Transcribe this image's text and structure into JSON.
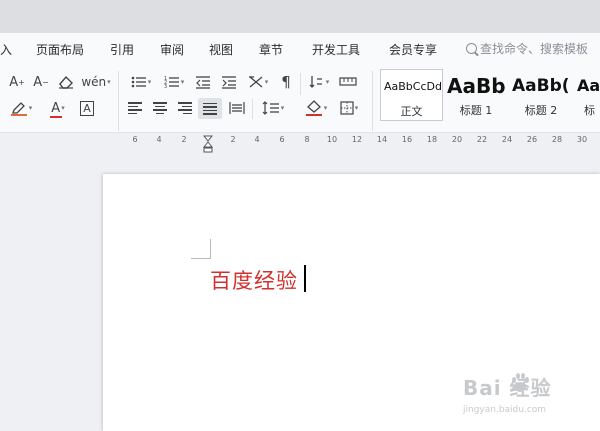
{
  "menu": {
    "items": [
      "入",
      "页面布局",
      "引用",
      "审阅",
      "视图",
      "章节",
      "开发工具",
      "会员专享"
    ],
    "search_placeholder": "查找命令、搜索模板"
  },
  "toolbar": {
    "row1": {
      "font_grow_icon": "font-grow-icon",
      "font_shrink_icon": "font-shrink-icon",
      "clear_format_icon": "eraser-icon",
      "phonetic_label": "wén",
      "bullets_icon": "bullets-list-icon",
      "numbering_icon": "numbered-list-icon",
      "outdent_icon": "outdent-icon",
      "indent_icon": "indent-icon",
      "chinese_layout_icon": "chinese-layout-icon",
      "show_marks_icon": "paragraph-mark-icon",
      "sort_icon": "sort-icon",
      "tab_ruler_icon": "tab-ruler-icon"
    },
    "row2": {
      "highlight_icon": "highlighter-icon",
      "font_color_label": "A",
      "char_border_label": "A",
      "align_left_icon": "align-left-icon",
      "align_center_icon": "align-center-icon",
      "align_right_icon": "align-right-icon",
      "justify_icon": "align-justify-icon",
      "distributed_icon": "align-distributed-icon",
      "line_spacing_icon": "line-spacing-icon",
      "shading_icon": "paint-bucket-icon",
      "borders_icon": "borders-icon"
    },
    "colors": {
      "accent_red": "#d0312d",
      "active_bg": "#dfe2e7"
    }
  },
  "styles": [
    {
      "sample": "AaBbCcDd",
      "name": "正文",
      "selected": true
    },
    {
      "sample": "AaBb",
      "name": "标题 1",
      "selected": false
    },
    {
      "sample": "AaBb(",
      "name": "标题 2",
      "selected": false
    },
    {
      "sample": "Aa",
      "name": "标",
      "selected": false
    }
  ],
  "ruler": {
    "labels": [
      "6",
      "4",
      "2",
      "2",
      "4",
      "6",
      "8",
      "10",
      "12",
      "14",
      "16",
      "18",
      "20",
      "22",
      "24",
      "26",
      "28",
      "30"
    ]
  },
  "document": {
    "text": "百度经验",
    "text_color": "#d0312d"
  },
  "watermark": {
    "main": "Bai  经验",
    "sub": "jingyan.baidu.com"
  }
}
